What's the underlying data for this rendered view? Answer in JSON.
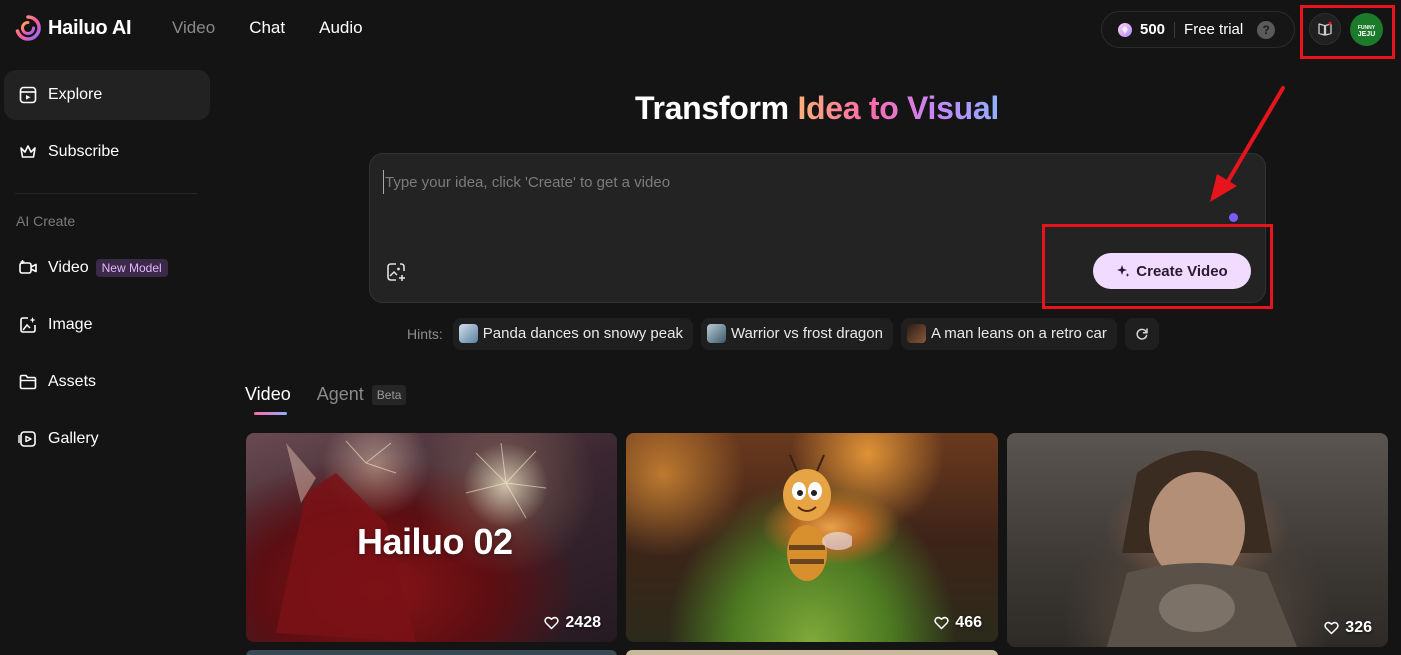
{
  "brand": {
    "name": "Hailuo AI"
  },
  "top_nav": [
    {
      "label": "Video",
      "active": false
    },
    {
      "label": "Chat",
      "active": true
    },
    {
      "label": "Audio",
      "active": true
    }
  ],
  "credits": {
    "amount": "500",
    "plan_label": "Free trial",
    "help": "?"
  },
  "avatar": {
    "line1": "FUNNY",
    "line2": "JEJU",
    "color": "#1c7a2b"
  },
  "sidebar": {
    "items": [
      {
        "label": "Explore",
        "icon": "explore-icon",
        "active": true
      },
      {
        "label": "Subscribe",
        "icon": "crown-icon",
        "active": false
      }
    ],
    "section_label": "AI Create",
    "create_items": [
      {
        "label": "Video",
        "icon": "video-add-icon",
        "badge": "New Model"
      },
      {
        "label": "Image",
        "icon": "image-sparkle-icon"
      },
      {
        "label": "Assets",
        "icon": "folder-icon"
      },
      {
        "label": "Gallery",
        "icon": "gallery-icon"
      }
    ]
  },
  "hero": {
    "title_plain": "Transform",
    "title_gradient": "Idea to Visual"
  },
  "prompt": {
    "placeholder": "Type your idea, click 'Create' to get a video",
    "value": "",
    "create_label": "Create Video"
  },
  "hints": {
    "label": "Hints:",
    "chips": [
      {
        "label": "Panda dances on snowy peak",
        "thumb_color": "#7da2c4"
      },
      {
        "label": "Warrior vs frost dragon",
        "thumb_color": "#5e7f93"
      },
      {
        "label": "A man leans on a retro car",
        "thumb_color": "#5a3e2c"
      }
    ]
  },
  "tabs": [
    {
      "label": "Video",
      "active": true
    },
    {
      "label": "Agent",
      "active": false,
      "badge": "Beta"
    }
  ],
  "videos": [
    {
      "title": "Hailuo 02",
      "likes": "2428"
    },
    {
      "title": "",
      "likes": "466"
    },
    {
      "title": "",
      "likes": "326"
    }
  ],
  "colors": {
    "annotation_red": "#e8141b",
    "create_button_bg": "#f1dcff",
    "accent_purple": "#7b5cff"
  }
}
